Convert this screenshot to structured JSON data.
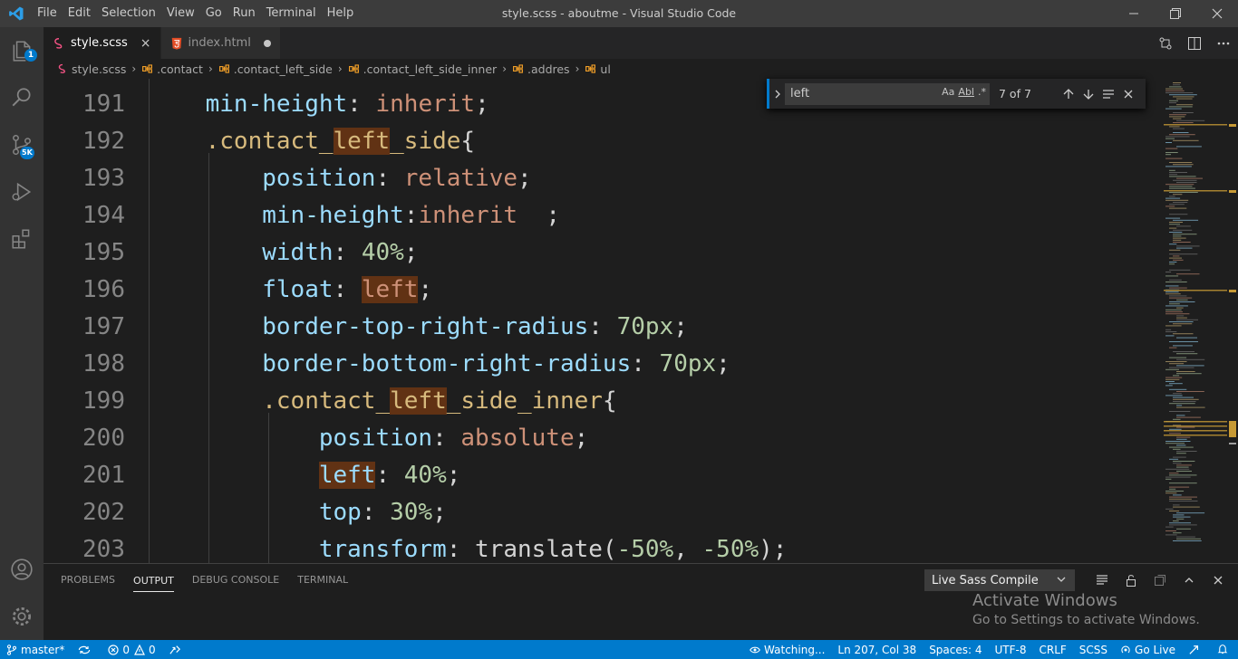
{
  "window": {
    "title": "style.scss - aboutme - Visual Studio Code",
    "menu": [
      "File",
      "Edit",
      "Selection",
      "View",
      "Go",
      "Run",
      "Terminal",
      "Help"
    ]
  },
  "activity_bar": {
    "explorer_badge": "1",
    "source_control_badge": "5K"
  },
  "tabs": [
    {
      "label": "style.scss",
      "active": true,
      "close": "×"
    },
    {
      "label": "index.html",
      "active": false,
      "modified": true
    }
  ],
  "breadcrumb": [
    "style.scss",
    ".contact",
    ".contact_left_side",
    ".contact_left_side_inner",
    ".addres",
    "ul"
  ],
  "find": {
    "query": "left",
    "options": [
      "Aa",
      "Abl",
      ".*"
    ],
    "result_count": "7 of 7"
  },
  "editor": {
    "line_numbers": [
      "191",
      "192",
      "193",
      "194",
      "195",
      "196",
      "197",
      "198",
      "199",
      "200",
      "201",
      "202",
      "203"
    ],
    "colors": {
      "property": "#9cdcfe",
      "selector": "#d7ba7d",
      "string": "#ce9178",
      "number": "#b5cea8",
      "punctuation": "#d4d4d4",
      "match_highlight": "#613214"
    },
    "lines": [
      {
        "indent": "    ",
        "tokens": [
          [
            "prop",
            "min-height"
          ],
          [
            "pun",
            ": "
          ],
          [
            "str",
            "inherit"
          ],
          [
            "pun",
            ";"
          ]
        ]
      },
      {
        "indent": "    ",
        "tokens": [
          [
            "sel",
            ".contact_"
          ],
          [
            "hl-sel",
            "left"
          ],
          [
            "sel",
            "_side"
          ],
          [
            "pun",
            "{"
          ]
        ]
      },
      {
        "indent": "        ",
        "tokens": [
          [
            "prop",
            "position"
          ],
          [
            "pun",
            ": "
          ],
          [
            "str",
            "relative"
          ],
          [
            "pun",
            ";"
          ]
        ]
      },
      {
        "indent": "        ",
        "tokens": [
          [
            "prop",
            "min-height"
          ],
          [
            "pun",
            ":"
          ],
          [
            "str",
            "inherit"
          ],
          [
            "pun",
            "  ;"
          ]
        ]
      },
      {
        "indent": "        ",
        "tokens": [
          [
            "prop",
            "width"
          ],
          [
            "pun",
            ": "
          ],
          [
            "num",
            "40%"
          ],
          [
            "pun",
            ";"
          ]
        ]
      },
      {
        "indent": "        ",
        "tokens": [
          [
            "prop",
            "float"
          ],
          [
            "pun",
            ": "
          ],
          [
            "hl-str",
            "left"
          ],
          [
            "pun",
            ";"
          ]
        ]
      },
      {
        "indent": "        ",
        "tokens": [
          [
            "prop",
            "border-top-right-radius"
          ],
          [
            "pun",
            ": "
          ],
          [
            "num",
            "70px"
          ],
          [
            "pun",
            ";"
          ]
        ]
      },
      {
        "indent": "        ",
        "tokens": [
          [
            "prop",
            "border-bottom-right-radius"
          ],
          [
            "pun",
            ": "
          ],
          [
            "num",
            "70px"
          ],
          [
            "pun",
            ";"
          ]
        ]
      },
      {
        "indent": "        ",
        "tokens": [
          [
            "sel",
            ".contact_"
          ],
          [
            "hl-sel",
            "left"
          ],
          [
            "sel",
            "_side_inner"
          ],
          [
            "pun",
            "{"
          ]
        ]
      },
      {
        "indent": "            ",
        "tokens": [
          [
            "prop",
            "position"
          ],
          [
            "pun",
            ": "
          ],
          [
            "str",
            "absolute"
          ],
          [
            "pun",
            ";"
          ]
        ]
      },
      {
        "indent": "            ",
        "tokens": [
          [
            "hl-prop",
            "left"
          ],
          [
            "pun",
            ": "
          ],
          [
            "num",
            "40%"
          ],
          [
            "pun",
            ";"
          ]
        ]
      },
      {
        "indent": "            ",
        "tokens": [
          [
            "prop",
            "top"
          ],
          [
            "pun",
            ": "
          ],
          [
            "num",
            "30%"
          ],
          [
            "pun",
            ";"
          ]
        ]
      },
      {
        "indent": "            ",
        "tokens": [
          [
            "prop",
            "transform"
          ],
          [
            "pun",
            ": "
          ],
          [
            "pun",
            "translate("
          ],
          [
            "num",
            "-50%"
          ],
          [
            "pun",
            ", "
          ],
          [
            "num",
            "-50%"
          ],
          [
            "pun",
            ");"
          ]
        ]
      }
    ]
  },
  "panel": {
    "tabs": [
      "PROBLEMS",
      "OUTPUT",
      "DEBUG CONSOLE",
      "TERMINAL"
    ],
    "active_tab": "OUTPUT",
    "output_channel": "Live Sass Compile",
    "watermark_title": "Activate Windows",
    "watermark_sub": "Go to Settings to activate Windows."
  },
  "statusbar": {
    "branch": "master*",
    "errors": "0",
    "warnings": "0",
    "watching": "Watching...",
    "position": "Ln 207, Col 38",
    "spaces": "Spaces: 4",
    "encoding": "UTF-8",
    "eol": "CRLF",
    "language": "SCSS",
    "go_live": "Go Live"
  }
}
